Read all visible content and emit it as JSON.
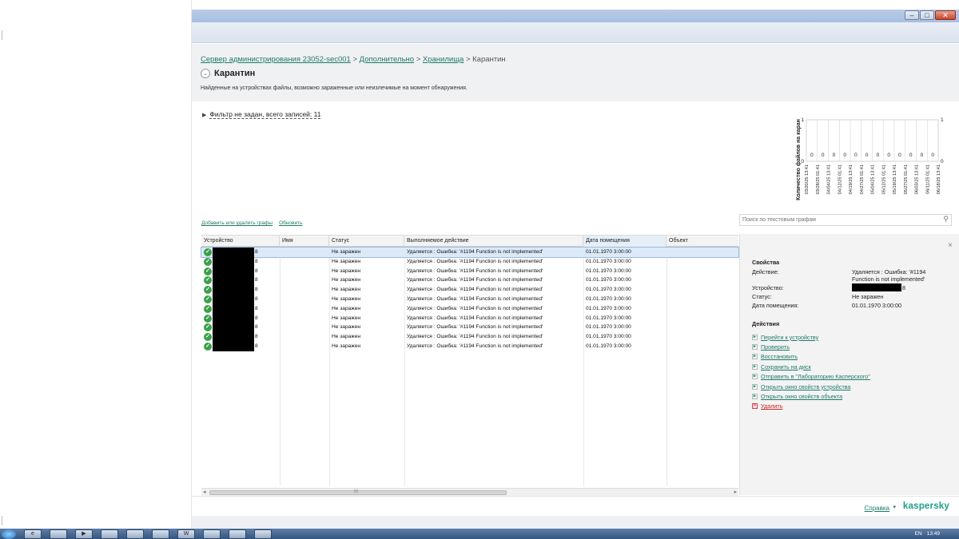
{
  "window": {
    "controls": {
      "minimize": "–",
      "maximize": "□",
      "close": "✕"
    }
  },
  "breadcrumb": {
    "items": [
      "Сервер администрирования 23052-sec001",
      "Дополнительно",
      "Хранилища"
    ],
    "current": "Карантин",
    "separator": ">"
  },
  "page": {
    "title": "Карантин",
    "description": "Найденные на устройствах файлы, возможно зараженные или неизлечимые на момент обнаружения."
  },
  "filter": {
    "label": "Фильтр не задан, всего записей: 11"
  },
  "chart_data": {
    "type": "bar",
    "ylabel": "Количество файлов на каран",
    "ylim": [
      0,
      1
    ],
    "yticks": [
      "1",
      "0"
    ],
    "categories": [
      "03/20/25 13:41",
      "03/28/25 01:41",
      "04/04/25 13:41",
      "04/12/25 01:41",
      "04/19/25 13:41",
      "04/27/25 01:41",
      "05/04/25 13:41",
      "05/12/25 01:41",
      "05/19/25 13:41",
      "05/27/25 01:41",
      "06/03/25 13:41",
      "06/11/25 01:41",
      "06/18/25 13:41"
    ],
    "values": [
      0,
      0,
      0,
      0,
      0,
      0,
      0,
      0,
      0,
      0,
      0,
      0
    ],
    "value_labels": [
      "0",
      "0",
      "0",
      "0",
      "0",
      "0",
      "0",
      "0",
      "0",
      "0",
      "0",
      "0"
    ],
    "grid": true
  },
  "links": {
    "add_remove": "Добавить или удалить графы",
    "refresh": "Обновить"
  },
  "search": {
    "placeholder": "Поиск по текстовым графам"
  },
  "table": {
    "columns": [
      "Устройство",
      "Имя",
      "Статус",
      "Выполняемое действие",
      "Дата помещения",
      "Объект"
    ],
    "rows": [
      {
        "device_suffix": "8",
        "name": "",
        "status": "Не заражен",
        "action": "Удаляется : Ошибка: '#1194 Function is not implemented'",
        "date": "01.01.1970 3:00:00",
        "object": ""
      },
      {
        "device_suffix": "8",
        "name": "",
        "status": "Не заражен",
        "action": "Удаляется : Ошибка: '#1194 Function is not implemented'",
        "date": "01.01.1970 3:00:00",
        "object": ""
      },
      {
        "device_suffix": "8",
        "name": "",
        "status": "Не заражен",
        "action": "Удаляется : Ошибка: '#1194 Function is not implemented'",
        "date": "01.01.1970 3:00:00",
        "object": ""
      },
      {
        "device_suffix": "8",
        "name": "",
        "status": "Не заражен",
        "action": "Удаляется : Ошибка: '#1194 Function is not implemented'",
        "date": "01.01.1970 3:00:00",
        "object": ""
      },
      {
        "device_suffix": "8",
        "name": "",
        "status": "Не заражен",
        "action": "Удаляется : Ошибка: '#1194 Function is not implemented'",
        "date": "01.01.1970 3:00:00",
        "object": ""
      },
      {
        "device_suffix": "8",
        "name": "",
        "status": "Не заражен",
        "action": "Удаляется : Ошибка: '#1194 Function is not implemented'",
        "date": "01.01.1970 3:00:00",
        "object": ""
      },
      {
        "device_suffix": "8",
        "name": "",
        "status": "Не заражен",
        "action": "Удаляется : Ошибка: '#1194 Function is not implemented'",
        "date": "01.01.1970 3:00:00",
        "object": ""
      },
      {
        "device_suffix": "8",
        "name": "",
        "status": "Не заражен",
        "action": "Удаляется : Ошибка: '#1194 Function is not implemented'",
        "date": "01.01.1970 3:00:00",
        "object": ""
      },
      {
        "device_suffix": "8",
        "name": "",
        "status": "Не заражен",
        "action": "Удаляется : Ошибка: '#1194 Function is not implemented'",
        "date": "01.01.1970 3:00:00",
        "object": ""
      },
      {
        "device_suffix": "8",
        "name": "",
        "status": "Не заражен",
        "action": "Удаляется : Ошибка: '#1194 Function is not implemented'",
        "date": "01.01.1970 3:00:00",
        "object": ""
      },
      {
        "device_suffix": "8",
        "name": "",
        "status": "Не заражен",
        "action": "Удаляется : Ошибка: '#1194 Function is not implemented'",
        "date": "01.01.1970 3:00:00",
        "object": ""
      }
    ],
    "scroll_grip": "III",
    "scroll_left": "◂",
    "scroll_right": "▸"
  },
  "details": {
    "close": "×",
    "properties_header": "Свойства",
    "action_label": "Действие:",
    "action_value_line1": "Удаляется : Ошибка: '#1194",
    "action_value_line2": "Function is not implemented'",
    "device_label": "Устройство:",
    "device_suffix": "8",
    "status_label": "Статус:",
    "status_value": "Не заражен",
    "date_label": "Дата помещения:",
    "date_value": "01.01.1970 3:00:00",
    "actions_header": "Действия",
    "actions": [
      "Перейти к устройству",
      "Проверить",
      "Восстановить",
      "Сохранить на диск",
      "Отправить в \"Лабораторию Касперского\"",
      "Открыть окно свойств устройства",
      "Открыть окно свойств объекта",
      "Удалить"
    ]
  },
  "footer": {
    "help": "Справка",
    "brand": "kaspersky"
  },
  "taskbar": {
    "lang": "EN",
    "time": "13:49"
  },
  "colors": {
    "link": "#1e7a6a",
    "brand": "#1e9e86",
    "ok": "#3aa04a",
    "delete": "#cc2222"
  }
}
